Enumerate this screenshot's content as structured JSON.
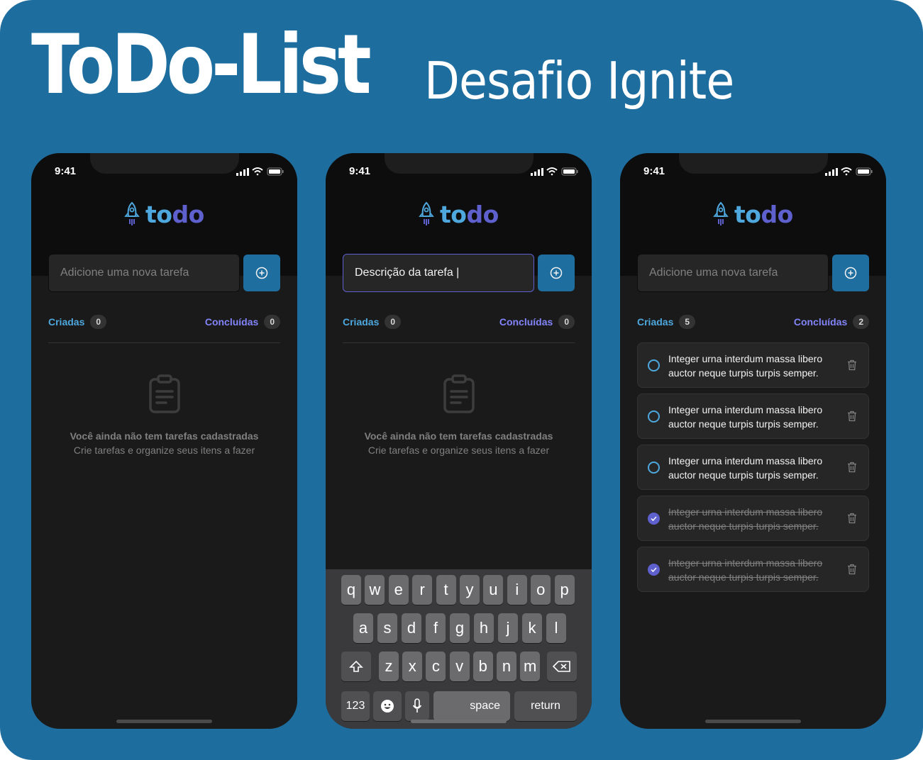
{
  "header": {
    "title": "ToDo-List",
    "subtitle": "Desafio Ignite"
  },
  "colors": {
    "background": "#1e6d9f",
    "blue": "#4ea8de",
    "purple": "#5e60ce",
    "purple_light": "#8284fa",
    "button": "#1e6f9f"
  },
  "phones": [
    {
      "time": "9:41",
      "logo": {
        "part1": "to",
        "part2": "do"
      },
      "input_placeholder": "Adicione uma nova tarefa",
      "created_label": "Criadas",
      "created_count": "0",
      "done_label": "Concluídas",
      "done_count": "0",
      "empty_title": "Você ainda não tem tarefas cadastradas",
      "empty_subtitle": "Crie tarefas e organize seus itens a fazer"
    },
    {
      "time": "9:41",
      "logo": {
        "part1": "to",
        "part2": "do"
      },
      "input_value": "Descrição da tarefa |",
      "created_label": "Criadas",
      "created_count": "0",
      "done_label": "Concluídas",
      "done_count": "0",
      "empty_title": "Você ainda não tem tarefas cadastradas",
      "empty_subtitle": "Crie tarefas e organize seus itens a fazer",
      "keyboard": {
        "row1": [
          "q",
          "w",
          "e",
          "r",
          "t",
          "y",
          "u",
          "i",
          "o",
          "p"
        ],
        "row2": [
          "a",
          "s",
          "d",
          "f",
          "g",
          "h",
          "j",
          "k",
          "l"
        ],
        "row3": [
          "z",
          "x",
          "c",
          "v",
          "b",
          "n",
          "m"
        ],
        "numbers": "123",
        "space": "space",
        "return": "return"
      }
    },
    {
      "time": "9:41",
      "logo": {
        "part1": "to",
        "part2": "do"
      },
      "input_placeholder": "Adicione uma nova tarefa",
      "created_label": "Criadas",
      "created_count": "5",
      "done_label": "Concluídas",
      "done_count": "2",
      "tasks": [
        {
          "line1": "Integer urna interdum massa libero",
          "line2": "auctor neque turpis turpis semper.",
          "done": false
        },
        {
          "line1": "Integer urna interdum massa libero",
          "line2": "auctor neque turpis turpis semper.",
          "done": false
        },
        {
          "line1": "Integer urna interdum massa libero",
          "line2": "auctor neque turpis turpis semper.",
          "done": false
        },
        {
          "line1": "Integer urna interdum massa libero",
          "line2": "auctor neque turpis turpis semper.",
          "done": true
        },
        {
          "line1": "Integer urna interdum massa libero",
          "line2": "auctor neque turpis turpis semper.",
          "done": true
        }
      ]
    }
  ]
}
